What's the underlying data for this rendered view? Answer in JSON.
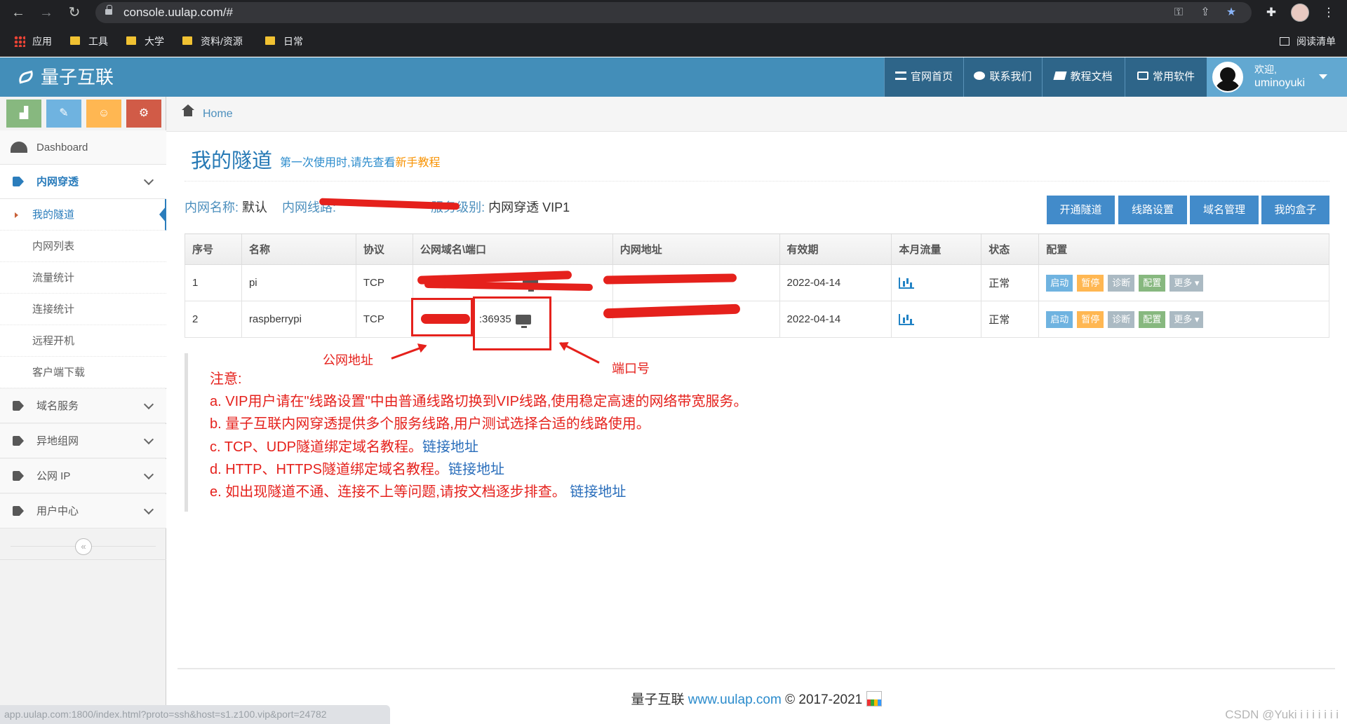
{
  "browser": {
    "url": "console.uulap.com/#",
    "bookmarks": [
      "应用",
      "工具",
      "大学",
      "资料/资源",
      "日常"
    ],
    "reading_list": "阅读清单"
  },
  "header": {
    "brand": "量子互联",
    "nav": [
      "官网首页",
      "联系我们",
      "教程文档",
      "常用软件"
    ],
    "welcome": "欢迎,",
    "username": "uminoyuki"
  },
  "sidebar": {
    "dashboard": "Dashboard",
    "tunnel_group": "内网穿透",
    "tunnel_sub": [
      "我的隧道",
      "内网列表",
      "流量统计",
      "连接统计",
      "远程开机",
      "客户端下载"
    ],
    "other_groups": [
      "域名服务",
      "异地组网",
      "公网 IP",
      "用户中心"
    ],
    "collapse_glyph": "«"
  },
  "breadcrumb": {
    "home": "Home"
  },
  "page": {
    "title": "我的隧道",
    "subtitle_prefix": "第一次使用时,请先查看",
    "subtitle_link": "新手教程"
  },
  "info": {
    "net_name_label": "内网名称:",
    "net_name_value": "默认",
    "route_label": "内网线路:",
    "level_label": "服务级别:",
    "level_value": "内网穿透 VIP1"
  },
  "actions": [
    "开通隧道",
    "线路设置",
    "域名管理",
    "我的盒子"
  ],
  "colors": {
    "header_blue": "#438eb9",
    "nav_dark": "#2e6589",
    "btn_blue": "#428bca",
    "btn_start": "#6fb3e0",
    "btn_pause": "#ffb752",
    "btn_diag": "#abbac3",
    "btn_config": "#87b87f",
    "btn_more": "#abbac3",
    "annotation_red": "#e5211c"
  },
  "table": {
    "headers": [
      "序号",
      "名称",
      "协议",
      "公网域名\\端口",
      "内网地址",
      "有效期",
      "本月流量",
      "状态",
      "配置"
    ],
    "rows": [
      {
        "no": "1",
        "name": "pi",
        "proto": "TCP",
        "public": "",
        "local": "",
        "expiry": "2022-04-14",
        "status": "正常"
      },
      {
        "no": "2",
        "name": "raspberrypi",
        "proto": "TCP",
        "public": ":36935",
        "local": "",
        "expiry": "2022-04-14",
        "status": "正常"
      }
    ],
    "row_actions": [
      "启动",
      "暂停",
      "诊断",
      "配置",
      "更多"
    ]
  },
  "annotations": {
    "public_addr": "公网地址",
    "port": "端口号"
  },
  "notice": {
    "title": "注意:",
    "a": "a. VIP用户请在\"线路设置\"中由普通线路切换到VIP线路,使用稳定高速的网络带宽服务。",
    "b": "b. 量子互联内网穿透提供多个服务线路,用户测试选择合适的线路使用。",
    "c": "c. TCP、UDP隧道绑定域名教程。",
    "d": "d. HTTP、HTTPS隧道绑定域名教程。",
    "e": "e. 如出现隧道不通、连接不上等问题,请按文档逐步排查。",
    "link": "链接地址"
  },
  "footer": {
    "brand": "量子互联",
    "site": "www.uulap.com",
    "copyright": "© 2017-2021",
    "badge": "cnzz"
  },
  "status_url": "app.uulap.com:1800/index.html?proto=ssh&host=s1.z100.vip&port=24782",
  "watermark": "CSDN @Yuki i i i i i i i"
}
